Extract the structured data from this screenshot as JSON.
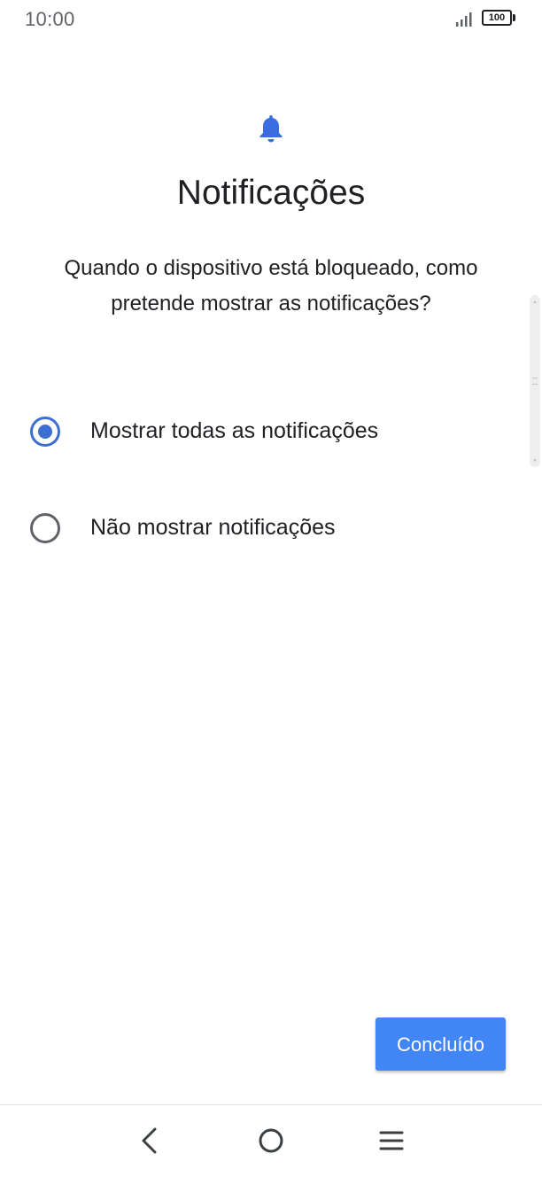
{
  "status_bar": {
    "time": "10:00",
    "battery_level": "100",
    "icons": [
      "signal-icon",
      "battery-icon"
    ]
  },
  "header": {
    "icon": "bell-icon",
    "title": "Notificações",
    "subtitle": "Quando o dispositivo está bloqueado, como pretende mostrar as notificações?"
  },
  "options": [
    {
      "label": "Mostrar todas as notificações",
      "selected": true
    },
    {
      "label": "Não mostrar notificações",
      "selected": false
    }
  ],
  "actions": {
    "done_label": "Concluído"
  },
  "nav_bar": {
    "icons": [
      "back-icon",
      "home-icon",
      "menu-icon"
    ]
  },
  "colors": {
    "accent": "#3c6fd1",
    "button": "#4285f4",
    "bell": "#3a6ee0",
    "text": "#202124",
    "muted": "#5f6368"
  }
}
